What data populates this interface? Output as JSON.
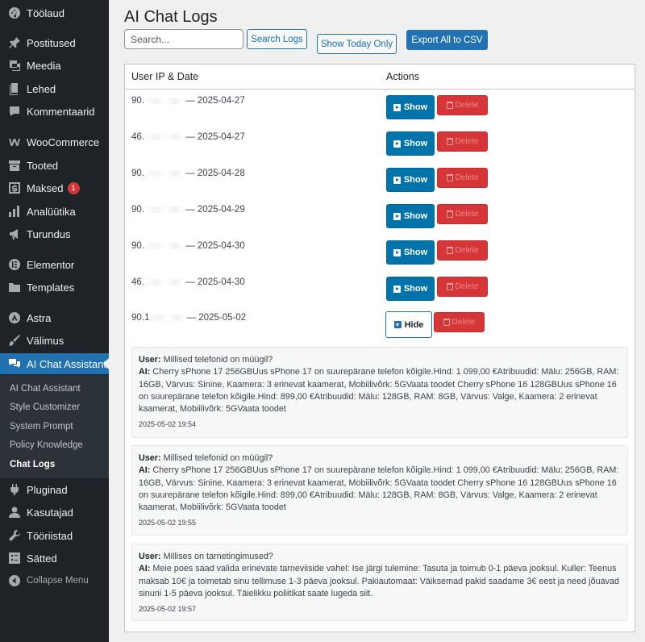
{
  "sidebar": {
    "items": [
      {
        "label": "Töölaud",
        "icon": "dashboard-icon"
      },
      {
        "label": "Postitused",
        "icon": "pin-icon"
      },
      {
        "label": "Meedia",
        "icon": "media-icon"
      },
      {
        "label": "Lehed",
        "icon": "pages-icon"
      },
      {
        "label": "Kommentaarid",
        "icon": "comment-icon"
      },
      {
        "label": "WooCommerce",
        "icon": "woo-icon"
      },
      {
        "label": "Tooted",
        "icon": "archive-icon"
      },
      {
        "label": "Maksed",
        "icon": "payments-icon",
        "badge": "1"
      },
      {
        "label": "Analüütika",
        "icon": "bar-chart-icon"
      },
      {
        "label": "Turundus",
        "icon": "megaphone-icon"
      },
      {
        "label": "Elementor",
        "icon": "elementor-icon"
      },
      {
        "label": "Templates",
        "icon": "folder-icon"
      },
      {
        "label": "Astra",
        "icon": "astra-icon"
      },
      {
        "label": "Välimus",
        "icon": "brush-icon"
      },
      {
        "label": "AI Chat Assistant",
        "icon": "chat-bubbles-icon"
      },
      {
        "label": "Pluginad",
        "icon": "plugin-icon"
      },
      {
        "label": "Kasutajad",
        "icon": "user-icon"
      },
      {
        "label": "Tööriistad",
        "icon": "wrench-icon"
      },
      {
        "label": "Sätted",
        "icon": "settings-icon"
      }
    ],
    "submenu": [
      "AI Chat Assistant",
      "Style Customizer",
      "System Prompt",
      "Policy Knowledge",
      "Chat Logs"
    ],
    "collapse_label": "Collapse Menu"
  },
  "page": {
    "title": "AI Chat Logs",
    "search_placeholder": "Search...",
    "search_button": "Search Logs",
    "today_button": "Show Today Only",
    "export_button": "Export All to CSV"
  },
  "table": {
    "col_user": "User IP & Date",
    "col_actions": "Actions",
    "show_label": "Show",
    "hide_label": "Hide",
    "delete_label": "Delete",
    "rows": [
      {
        "ip": "90.",
        "date": "— 2025-04-27",
        "expanded": false
      },
      {
        "ip": "46.",
        "date": "— 2025-04-27",
        "expanded": false
      },
      {
        "ip": "90.",
        "date": "— 2025-04-28",
        "expanded": false
      },
      {
        "ip": "90.",
        "date": "— 2025-04-29",
        "expanded": false
      },
      {
        "ip": "90.",
        "date": "— 2025-04-30",
        "expanded": false
      },
      {
        "ip": "46.",
        "date": "— 2025-04-30",
        "expanded": false
      },
      {
        "ip": "90.1",
        "date": "— 2025-05-02",
        "expanded": true
      }
    ]
  },
  "messages": {
    "user_prefix": "User:",
    "ai_prefix": "AI:",
    "items": [
      {
        "user": "Millised telefonid on müügil?",
        "ai": "Cherry sPhone 17 256GBUus sPhone 17 on suurepärane telefon kõigile.Hind: 1 099,00 €Atribuudid: Mälu: 256GB, RAM: 16GB, Värvus: Sinine, Kaamera: 3 erinevat kaamerat, Mobiilivõrk: 5GVaata toodet Cherry sPhone 16 128GBUus sPhone 16 on suurepärane telefon kõigile.Hind: 899,00 €Atribuudid: Mälu: 128GB, RAM: 8GB, Värvus: Valge, Kaamera: 2 erinevat kaamerat, Mobiilivõrk: 5GVaata toodet",
        "time": "2025-05-02 19:54"
      },
      {
        "user": "Millised telefonid on müügil?",
        "ai": "Cherry sPhone 17 256GBUus sPhone 17 on suurepärane telefon kõigile.Hind: 1 099,00 €Atribuudid: Mälu: 256GB, RAM: 16GB, Värvus: Sinine, Kaamera: 3 erinevat kaamerat, Mobiilivõrk: 5GVaata toodet Cherry sPhone 16 128GBUus sPhone 16 on suurepärane telefon kõigile.Hind: 899,00 €Atribuudid: Mälu: 128GB, RAM: 8GB, Värvus: Valge, Kaamera: 2 erinevat kaamerat, Mobiilivõrk: 5GVaata toodet",
        "time": "2025-05-02 19:55"
      },
      {
        "user": "Millises on tarnetingimused?",
        "ai": "Meie poes saad valida erinevate tarneviiside vahel: Ise järgi tulemine: Tasuta ja toimub 0-1 päeva jooksul. Kuller: Teenus maksab 10€ ja toimetab sinu tellimuse 1-3 päeva jooksul. Pakiautomaat: Väiksemad pakid saadame 3€ eest ja need jõuavad sinuni 1-5 päeva jooksul. Täielikku poliitikat saate lugeda siit.",
        "time": "2025-05-02 19:57"
      }
    ]
  },
  "colors": {
    "sidebar_bg": "#1d2327",
    "accent": "#2271b1",
    "show_button": "#0073aa",
    "delete_button": "#d63638",
    "badge": "#d63638"
  }
}
